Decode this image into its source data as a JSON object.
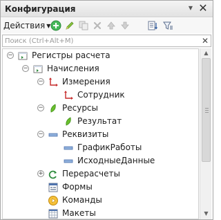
{
  "window": {
    "title": "Конфигурация",
    "pin_icon": "pin-icon",
    "close_icon": "close-icon"
  },
  "toolbar": {
    "actions_label": "Действия",
    "buttons": [
      {
        "name": "add-button",
        "icon": "plus-circle-icon",
        "color": "#2f9e44"
      },
      {
        "name": "edit-button",
        "icon": "pencil-icon",
        "color": "#7cb342"
      },
      {
        "name": "copy-button",
        "icon": "copy-icon",
        "color": "#b9b9b9"
      },
      {
        "name": "delete-button",
        "icon": "cross-icon",
        "color": "#b9b9b9"
      },
      {
        "name": "move-up-button",
        "icon": "arrow-up-icon",
        "color": "#b9b9b9"
      },
      {
        "name": "move-down-button",
        "icon": "arrow-down-icon",
        "color": "#b9b9b9"
      },
      {
        "name": "sort-button",
        "icon": "sort-list-icon",
        "color": "#5a6c8c"
      },
      {
        "name": "filter-button",
        "icon": "filter-icon",
        "color": "#5a6c8c"
      }
    ]
  },
  "search": {
    "placeholder": "Поиск (Ctrl+Alt+M)",
    "value": "",
    "clear_icon": "close-icon"
  },
  "tree": {
    "items": [
      {
        "label": "Регистры расчета",
        "icon": "register-icon",
        "toggle": "minus",
        "level": 0
      },
      {
        "label": "Начисления",
        "icon": "register-icon",
        "toggle": "minus",
        "level": 1
      },
      {
        "label": "Измерения",
        "icon": "dimension-icon",
        "toggle": "minus",
        "level": 2
      },
      {
        "label": "Сотрудник",
        "icon": "dimension-icon",
        "toggle": "none",
        "level": 3
      },
      {
        "label": "Ресурсы",
        "icon": "resource-icon",
        "toggle": "minus",
        "level": 2
      },
      {
        "label": "Результат",
        "icon": "resource-icon",
        "toggle": "none",
        "level": 3
      },
      {
        "label": "Реквизиты",
        "icon": "attribute-icon",
        "toggle": "minus",
        "level": 2
      },
      {
        "label": "ГрафикРаботы",
        "icon": "attribute-icon",
        "toggle": "none",
        "level": 3
      },
      {
        "label": "ИсходныеДанные",
        "icon": "attribute-icon",
        "toggle": "none",
        "level": 3
      },
      {
        "label": "Перерасчеты",
        "icon": "recalculation-icon",
        "toggle": "plus",
        "level": 2
      },
      {
        "label": "Формы",
        "icon": "form-icon",
        "toggle": "none",
        "level": 2
      },
      {
        "label": "Команды",
        "icon": "command-icon",
        "toggle": "none",
        "level": 2
      },
      {
        "label": "Макеты",
        "icon": "template-icon",
        "toggle": "none",
        "level": 2
      }
    ]
  },
  "colors": {
    "accent_green": "#2f9e44",
    "dimension_red": "#c62828",
    "resource_green": "#6abf2e",
    "attribute_blue": "#5b7fb8"
  }
}
